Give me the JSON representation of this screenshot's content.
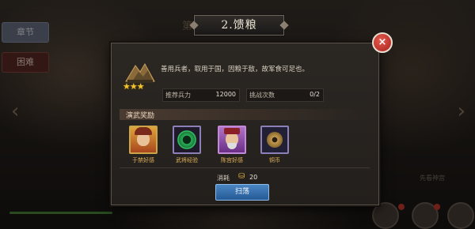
{
  "background": {
    "left_tabs": [
      "章节",
      "困难"
    ],
    "title_tag": "第",
    "bottom_right_label": "先看神宫",
    "arrows": {
      "left": "‹",
      "right": "›"
    }
  },
  "title": "2.馈粮",
  "close_label": "×",
  "stage": {
    "icon": "mountain-camp-icon",
    "stars": "★★★",
    "star_count": 3,
    "description": "善用兵者，取用于国，因粮于敌，故军食可足也。"
  },
  "stats": {
    "power_label": "推荐兵力",
    "power_value": "12000",
    "attempts_label": "挑战次数",
    "attempts_value": "0/2"
  },
  "rewards": {
    "header": "演武奖励",
    "items": [
      {
        "name": "于禁好感",
        "icon": "hero-portrait-yujin-icon"
      },
      {
        "name": "武将经验",
        "icon": "jade-disc-icon"
      },
      {
        "name": "陈宫好感",
        "icon": "hero-portrait-chengong-icon"
      },
      {
        "name": "铜币",
        "icon": "copper-coin-icon"
      }
    ]
  },
  "cost": {
    "label": "消耗",
    "icon": "gold-ingot-icon",
    "value": "20"
  },
  "sweep_label": "扫荡",
  "colors": {
    "reward_name": "#e1b25a",
    "button_blue": "#2f6ea9",
    "close_red": "#c63a2c",
    "star_gold": "#f2c230"
  }
}
